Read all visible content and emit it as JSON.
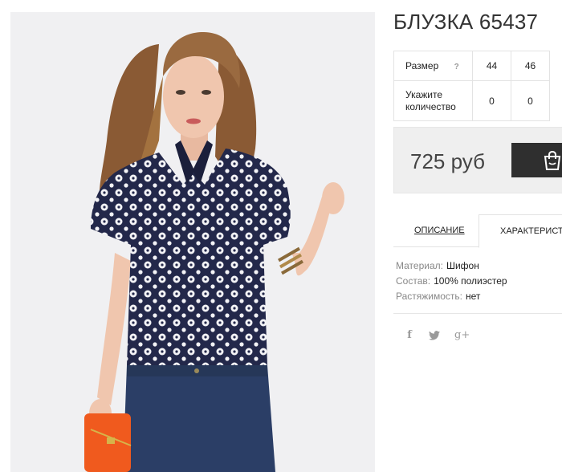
{
  "product": {
    "title": "БЛУЗКА 65437",
    "image_alt": "product-photo-model-blouse"
  },
  "sizes": {
    "size_label": "Размер",
    "help_icon": "?",
    "values": [
      "44",
      "46"
    ],
    "qty_label": "Укажите количество",
    "quantities": [
      "0",
      "0"
    ]
  },
  "price": {
    "amount": "725 руб",
    "cart_icon": "shopping-bag-icon"
  },
  "tabs": {
    "description": "ОПИСАНИЕ",
    "characteristics": "ХАРАКТЕРИСТИКИ"
  },
  "specs": [
    {
      "key": "Материал:",
      "value": "Шифон"
    },
    {
      "key": "Состав:",
      "value": "100% полиэстер"
    },
    {
      "key": "Растяжимость:",
      "value": "нет"
    }
  ],
  "social": {
    "facebook": "f",
    "twitter_icon": "twitter-icon",
    "gplus": "g+"
  },
  "colors": {
    "dark_button": "#2f2f2f",
    "price_bg": "#efefef",
    "blouse": "#23284a",
    "jeans": "#2b3e66",
    "bag": "#f05a1e"
  }
}
